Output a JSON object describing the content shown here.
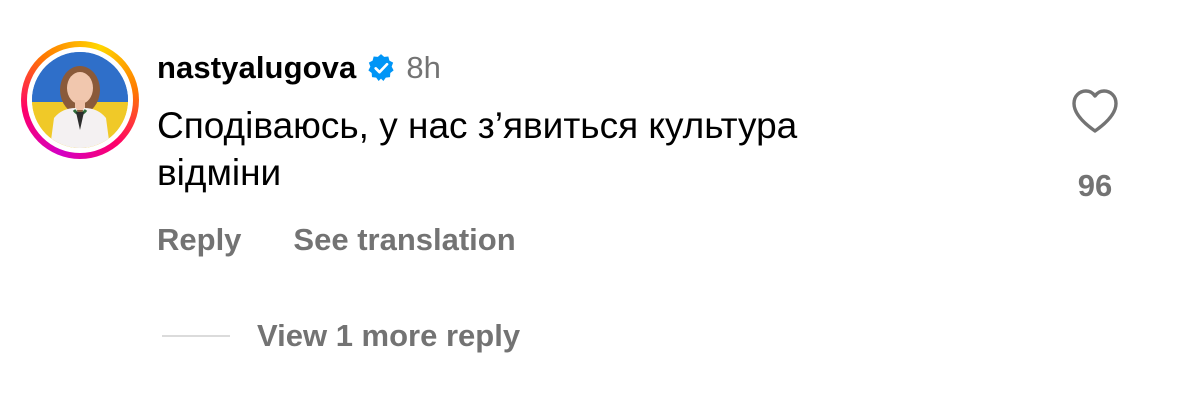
{
  "comment": {
    "username": "nastyalugova",
    "verified": true,
    "time": "8h",
    "text_line1": "Сподіваюсь, у нас з’явиться культура",
    "text_line2": "відміни",
    "like_count": "96",
    "actions": {
      "reply": "Reply",
      "see_translation": "See translation"
    },
    "view_replies": "View 1 more reply"
  },
  "icons": {
    "verified": "verified-badge-icon",
    "like": "heart-icon"
  },
  "colors": {
    "secondary_text": "#737373",
    "verified_blue": "#0095f6",
    "divider": "#dbdbdb"
  }
}
